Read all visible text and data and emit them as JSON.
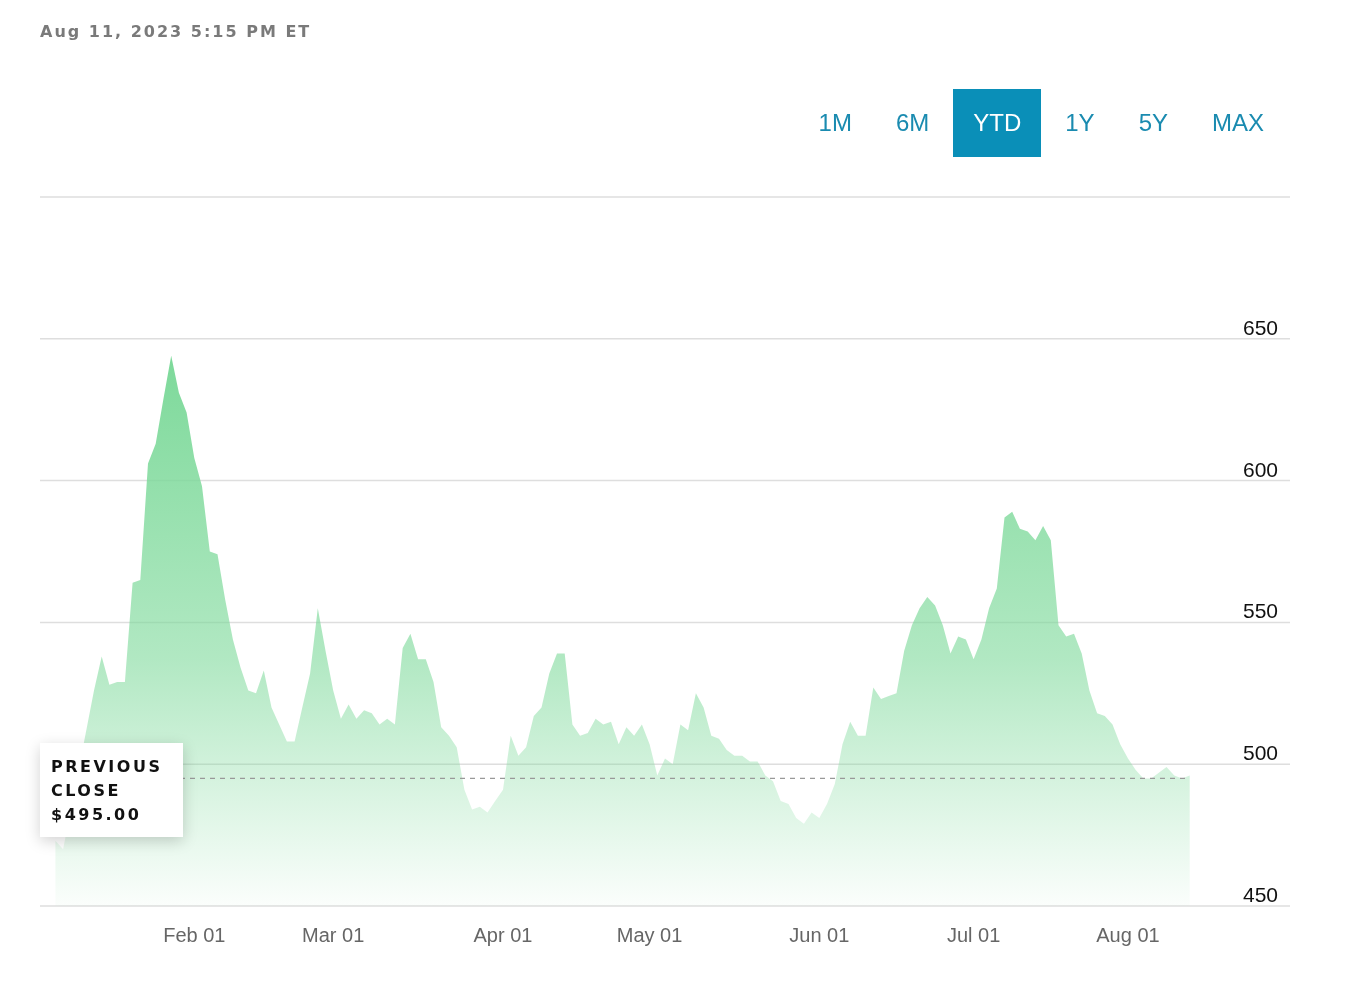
{
  "timestamp": "Aug 11, 2023 5:15 PM ET",
  "ranges": [
    {
      "label": "1M",
      "selected": false
    },
    {
      "label": "6M",
      "selected": false
    },
    {
      "label": "YTD",
      "selected": true
    },
    {
      "label": "1Y",
      "selected": false
    },
    {
      "label": "5Y",
      "selected": false
    },
    {
      "label": "MAX",
      "selected": false
    }
  ],
  "chart_data": {
    "type": "area",
    "grid": true,
    "ylim": [
      450,
      700
    ],
    "categories": [
      null,
      null,
      null,
      null,
      null,
      null,
      null,
      null,
      null,
      null,
      null,
      null,
      null,
      null,
      null,
      null,
      null,
      null,
      null,
      null,
      "Feb 01",
      null,
      null,
      null,
      null,
      null,
      null,
      null,
      null,
      null,
      null,
      null,
      null,
      null,
      null,
      null,
      null,
      null,
      "Mar 01",
      null,
      null,
      null,
      null,
      null,
      null,
      null,
      null,
      null,
      null,
      null,
      null,
      null,
      null,
      null,
      null,
      null,
      null,
      null,
      null,
      null,
      "Apr 01",
      null,
      null,
      null,
      null,
      null,
      null,
      null,
      null,
      null,
      null,
      null,
      null,
      null,
      null,
      null,
      null,
      null,
      null,
      "May 01",
      null,
      null,
      null,
      null,
      null,
      null,
      null,
      null,
      null,
      null,
      null,
      null,
      null,
      null,
      null,
      null,
      null,
      null,
      null,
      null,
      null,
      "Jun 01",
      null,
      null,
      null,
      null,
      null,
      null,
      null,
      null,
      null,
      null,
      null,
      null,
      null,
      null,
      null,
      null,
      null,
      null,
      null,
      "Jul 01",
      null,
      null,
      null,
      null,
      null,
      null,
      null,
      null,
      null,
      null,
      null,
      null,
      null,
      null,
      null,
      null,
      null,
      null,
      null,
      "Aug 01",
      null,
      null,
      null,
      null,
      null,
      null,
      null,
      null
    ],
    "yticks": [
      450,
      500,
      550,
      600,
      650
    ],
    "series": [
      {
        "color": "#7dd99a",
        "values": [
          null,
          null,
          473,
          470,
          null,
          null,
          null,
          526,
          538,
          528,
          529,
          529,
          564,
          565,
          606,
          613,
          629,
          644,
          631,
          624,
          608,
          598,
          575,
          574,
          558,
          544,
          534,
          526,
          525,
          533,
          520,
          514,
          508,
          508,
          520,
          532,
          555,
          540,
          526,
          516,
          521,
          516,
          519,
          518,
          514,
          516,
          514,
          541,
          546,
          537,
          537,
          529,
          513,
          510,
          506,
          491,
          484,
          485,
          483,
          487,
          491,
          510,
          503,
          506,
          517,
          520,
          532,
          539,
          539,
          514,
          510,
          511,
          516,
          514,
          515,
          507,
          513,
          510,
          514,
          507,
          496,
          502,
          500,
          514,
          512,
          525,
          520,
          510,
          509,
          505,
          503,
          503,
          501,
          501,
          496,
          494,
          487,
          486,
          481,
          479,
          483,
          481,
          486,
          493,
          507,
          515,
          510,
          510,
          527,
          523,
          524,
          525,
          540,
          549,
          555,
          559,
          556,
          549,
          539,
          545,
          544,
          537,
          544,
          555,
          562,
          587,
          589,
          583,
          582,
          579,
          584,
          579,
          549,
          545,
          546,
          539,
          526,
          518,
          517,
          514,
          507,
          502,
          498,
          495,
          495,
          497,
          499,
          496,
          495,
          496
        ]
      }
    ],
    "ref_lines": [
      {
        "axis": "y",
        "value": 495,
        "label": "PREVIOUS CLOSE"
      }
    ]
  },
  "previous_close": {
    "value": "$495.00"
  }
}
